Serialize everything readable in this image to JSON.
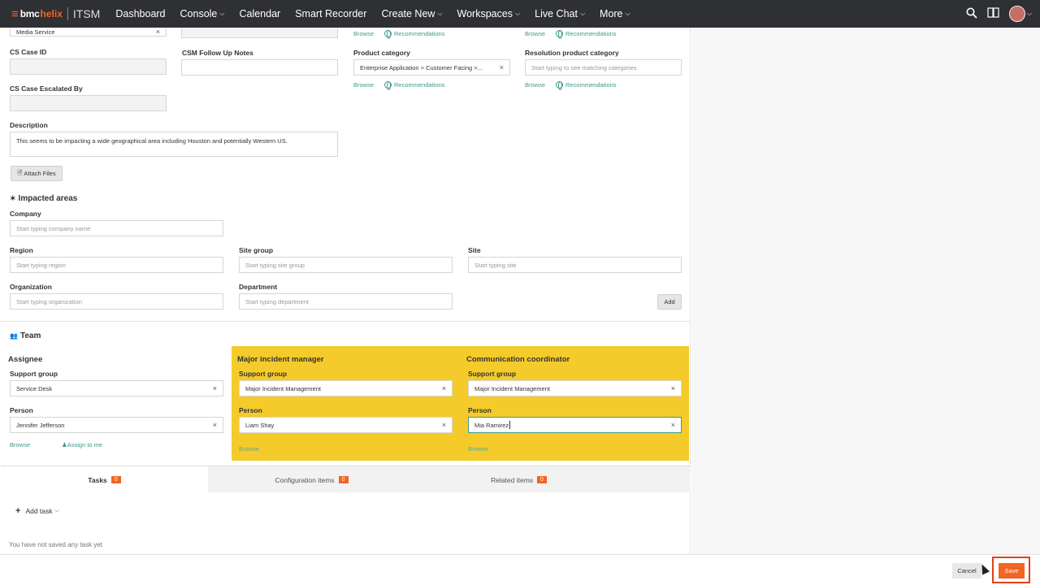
{
  "brand": {
    "bmc": "bmc",
    "helix": "helix",
    "product": "ITSM"
  },
  "nav": [
    {
      "label": "Dashboard"
    },
    {
      "label": "Console",
      "dropdown": true
    },
    {
      "label": "Calendar"
    },
    {
      "label": "Smart Recorder"
    },
    {
      "label": "Create New",
      "dropdown": true
    },
    {
      "label": "Workspaces",
      "dropdown": true
    },
    {
      "label": "Live Chat",
      "dropdown": true
    },
    {
      "label": "More",
      "dropdown": true
    }
  ],
  "icons": {
    "search": "search-icon",
    "book": "book-icon",
    "avatar": "user-avatar"
  },
  "form": {
    "service_value": "Media Service",
    "cs_case_id_label": "CS Case ID",
    "csm_notes_label": "CSM Follow Up Notes",
    "product_category_label": "Product category",
    "product_category_value": "Enterprise Application > Customer Facing >...",
    "resolution_category_label": "Resolution product category",
    "resolution_category_placeholder": "Start typing to see matching categories",
    "cs_escalated_label": "CS Case Escalated By",
    "description_label": "Description",
    "description_value": "This seems to be impacting a wide geographical area including Houston and potentially Western US.",
    "attach_label": "Attach Files",
    "browse": "Browse",
    "recommendations": "Recommendations"
  },
  "impacted": {
    "title": "Impacted areas",
    "company_label": "Company",
    "company_ph": "Start typing company name",
    "region_label": "Region",
    "region_ph": "Start typing region",
    "sitegroup_label": "Site group",
    "sitegroup_ph": "Start typing site group",
    "site_label": "Site",
    "site_ph": "Start typing site",
    "org_label": "Organization",
    "org_ph": "Start typing organization",
    "dept_label": "Department",
    "dept_ph": "Start typing department",
    "add": "Add"
  },
  "team": {
    "title": "Team",
    "assignee": {
      "title": "Assignee",
      "sg_label": "Support group",
      "sg_value": "Service Desk",
      "person_label": "Person",
      "person_value": "Jennifer Jefferson",
      "browse": "Browse",
      "assign_me": "Assign to me"
    },
    "mim": {
      "title": "Major incident manager",
      "sg_label": "Support group",
      "sg_value": "Major Incident Management",
      "person_label": "Person",
      "person_value": "Liam Shay",
      "browse": "Browse"
    },
    "cc": {
      "title": "Communication coordinator",
      "sg_label": "Support group",
      "sg_value": "Major Incident Management",
      "person_label": "Person",
      "person_value": "Mia Ramirez",
      "browse": "Browse"
    }
  },
  "tabs": [
    {
      "label": "Tasks",
      "count": "0"
    },
    {
      "label": "Configuration items",
      "count": "0"
    },
    {
      "label": "Related items",
      "count": "0"
    }
  ],
  "tasks": {
    "add_task": "Add task",
    "empty": "You have not saved any task yet"
  },
  "footer": {
    "cancel": "Cancel",
    "save": "Save"
  },
  "colors": {
    "accent": "#f26522",
    "yellow": "#f5cb2b",
    "link": "#3a9a8a",
    "topbar": "#2f3033"
  }
}
